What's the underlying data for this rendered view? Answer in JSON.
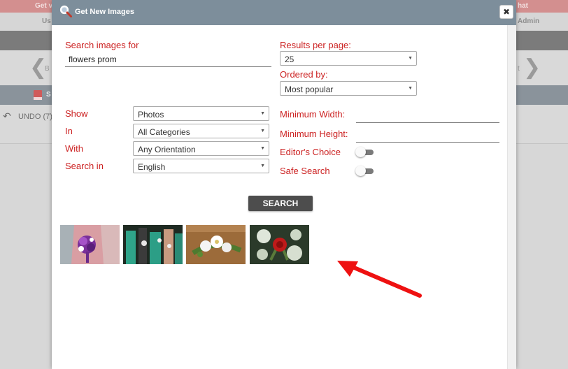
{
  "background": {
    "topbar": {
      "left_text": "Get v",
      "right_text": "hat"
    },
    "userrow": {
      "left_text": "Us",
      "right_text": "Admin"
    },
    "nav": {
      "back_label": "B",
      "next_label": "t"
    },
    "graybar": {
      "label": "S"
    },
    "undo": {
      "label": "UNDO (7)"
    }
  },
  "modal": {
    "title": "Get New Images",
    "close_label": "✖",
    "search_label": "Search images for",
    "search_value": "flowers prom",
    "results_label": "Results per page:",
    "results_value": "25",
    "ordered_label": "Ordered by:",
    "ordered_value": "Most popular",
    "filters": [
      {
        "label": "Show",
        "value": "Photos"
      },
      {
        "label": "In",
        "value": "All Categories"
      },
      {
        "label": "With",
        "value": "Any Orientation"
      },
      {
        "label": "Search in",
        "value": "English"
      }
    ],
    "min_width_label": "Minimum Width:",
    "min_width_value": "",
    "min_height_label": "Minimum Height:",
    "min_height_value": "",
    "editors_choice_label": "Editor's Choice",
    "editors_choice_on": false,
    "safe_search_label": "Safe Search",
    "safe_search_on": false,
    "search_button_label": "SEARCH"
  },
  "colors": {
    "label_red": "#cc2222",
    "header": "#7d8e9b",
    "button": "#4d4d4d",
    "arrow": "#ee1111"
  }
}
